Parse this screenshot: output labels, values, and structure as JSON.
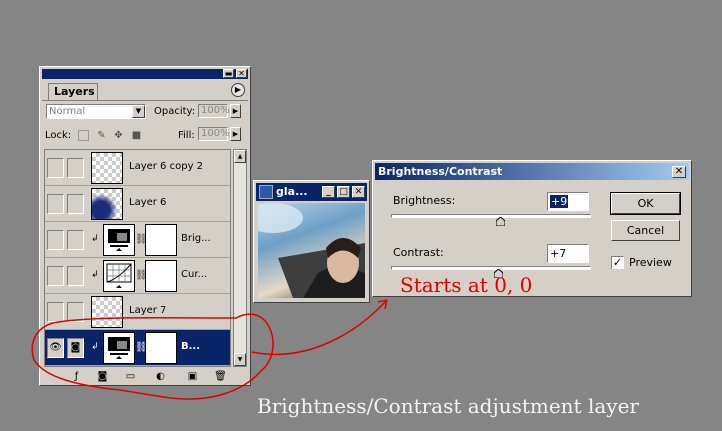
{
  "layers_panel": {
    "tab_label": "Layers",
    "blend_mode": "Normal",
    "opacity_label": "Opacity:",
    "opacity_value": "100%",
    "lock_label": "Lock:",
    "fill_label": "Fill:",
    "fill_value": "100%",
    "layers": [
      {
        "name": "Layer 6 copy 2",
        "thumb": "checker",
        "selected": false
      },
      {
        "name": "Layer 6",
        "thumb": "checker-blue",
        "selected": false
      },
      {
        "name": "Brig...",
        "thumb": "adjustment-brightness",
        "selected": false,
        "clipped": true
      },
      {
        "name": "Cur...",
        "thumb": "adjustment-curves",
        "selected": false,
        "clipped": true
      },
      {
        "name": "Layer 7",
        "thumb": "checker",
        "selected": false
      },
      {
        "name": "B...",
        "thumb": "adjustment-brightness",
        "selected": true,
        "clipped": true
      }
    ]
  },
  "image_window": {
    "title": "gla..."
  },
  "dialog": {
    "title": "Brightness/Contrast",
    "brightness_label": "Brightness:",
    "brightness_value": "+9",
    "contrast_label": "Contrast:",
    "contrast_value": "+7",
    "ok_label": "OK",
    "cancel_label": "Cancel",
    "preview_label": "Preview",
    "preview_checked": true
  },
  "annotations": {
    "red_note": "Starts at 0, 0",
    "caption": "Brightness/Contrast adjustment layer",
    "color": "#e00000"
  }
}
